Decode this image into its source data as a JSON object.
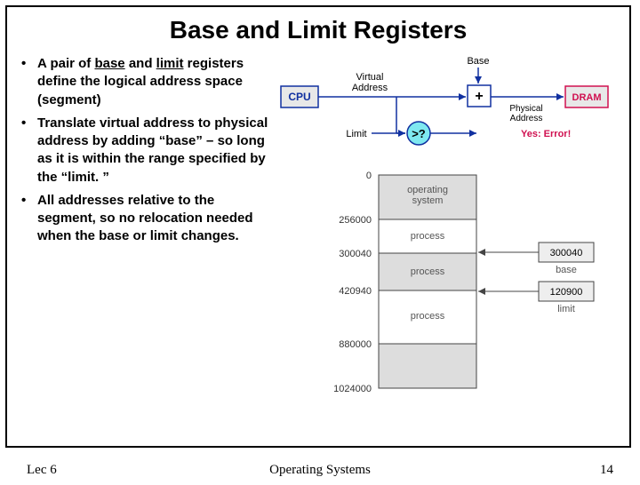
{
  "title": "Base and Limit Registers",
  "bullets": [
    {
      "pre": "A pair of ",
      "u1": "base",
      "mid": " and ",
      "u2": "limit",
      "post": " registers define the logical address space (segment)"
    },
    {
      "text": "Translate virtual address to physical address by adding “base” – so long as it is within the range specified by the “limit. ”"
    },
    {
      "text": "All addresses relative to the segment, so no relocation needed when the base or limit changes."
    }
  ],
  "pipeline": {
    "cpu": "CPU",
    "virtual": "Virtual",
    "address": "Address",
    "base": "Base",
    "plus": "+",
    "limit": "Limit",
    "cmp": ">?",
    "physical": "Physical",
    "paddress": "Address",
    "dram": "DRAM",
    "error": "Yes: Error!"
  },
  "memmap": {
    "ticks": [
      "0",
      "256000",
      "300040",
      "420940",
      "880000",
      "1024000"
    ],
    "labels": [
      "operating system",
      "process",
      "process",
      "process"
    ],
    "base_val": "300040",
    "base_lbl": "base",
    "limit_val": "120900",
    "limit_lbl": "limit"
  },
  "footer": {
    "left": "Lec 6",
    "center": "Operating Systems",
    "right": "14"
  }
}
